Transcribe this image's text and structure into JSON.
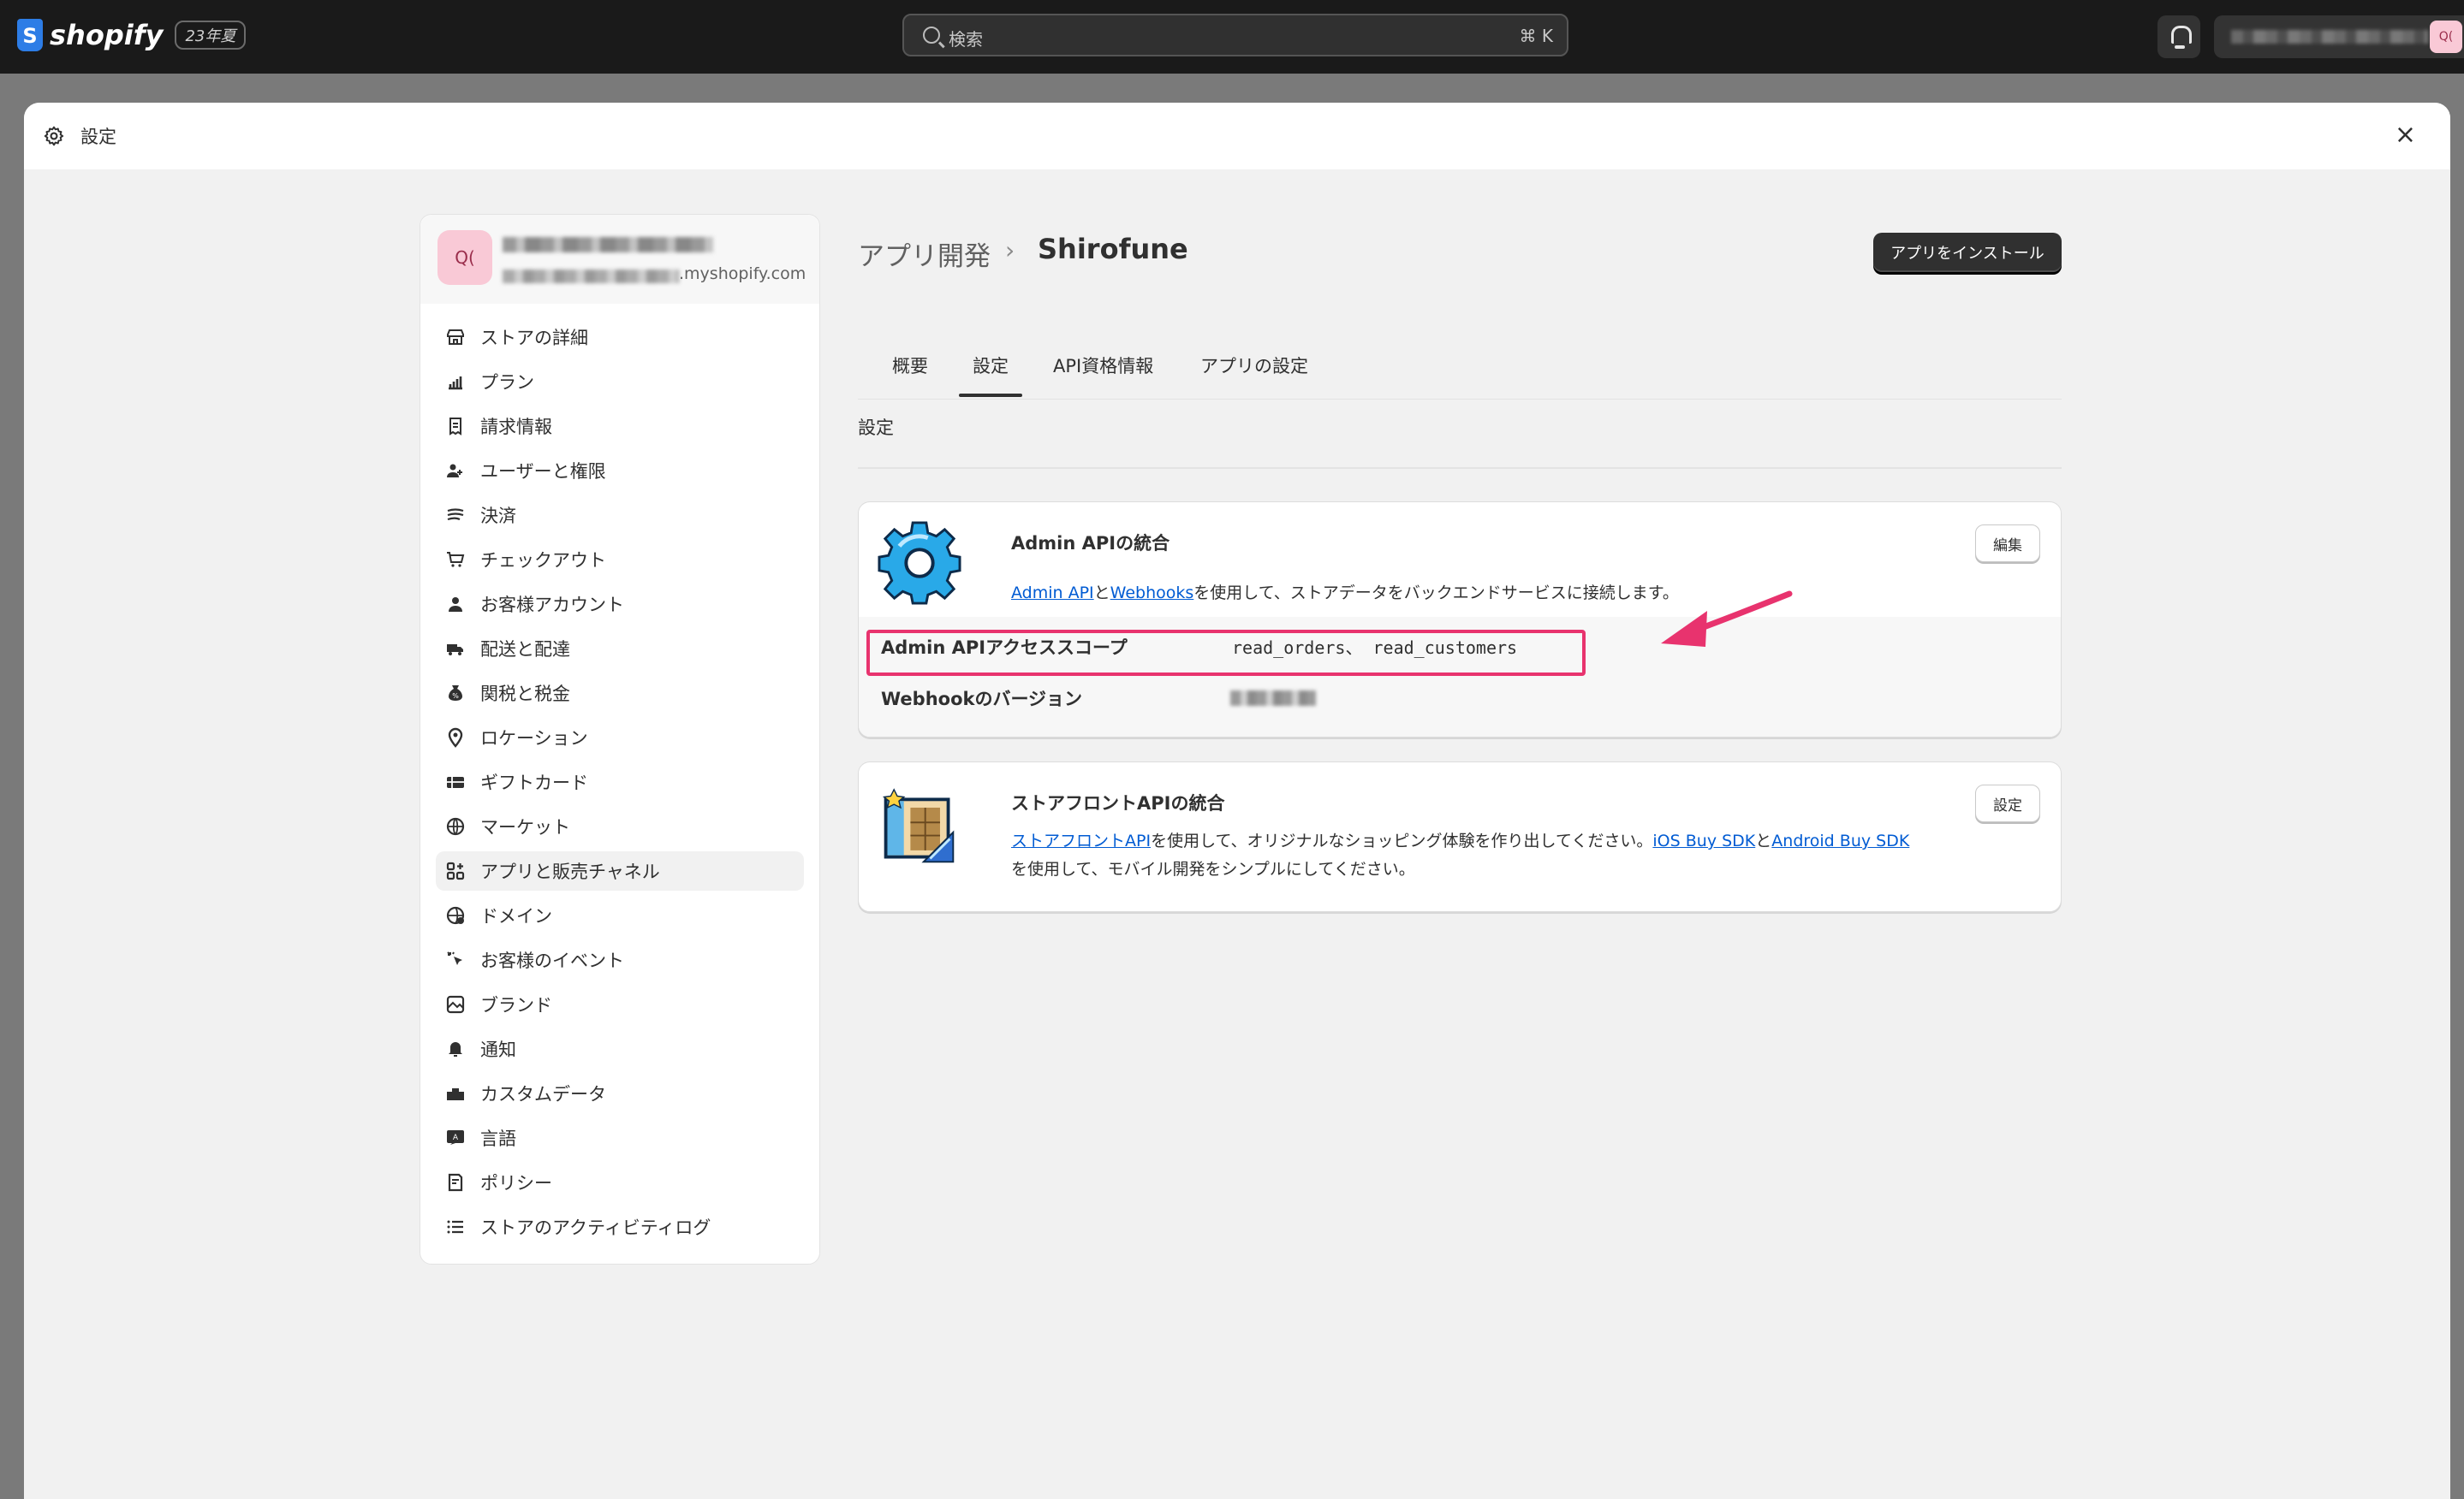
{
  "topbar": {
    "brand": "shopify",
    "brand_initial": "S",
    "edition": "23年夏",
    "search_placeholder": "検索",
    "search_shortcut": "⌘ K",
    "account_initials": "Q("
  },
  "modal": {
    "title": "設定",
    "close": "×"
  },
  "store": {
    "avatar": "Q(",
    "domain_suffix": ".myshopify.com"
  },
  "sidebar": {
    "items": [
      {
        "label": "ストアの詳細",
        "icon": "store-icon"
      },
      {
        "label": "プラン",
        "icon": "plan-icon"
      },
      {
        "label": "請求情報",
        "icon": "billing-icon"
      },
      {
        "label": "ユーザーと権限",
        "icon": "users-icon"
      },
      {
        "label": "決済",
        "icon": "payments-icon"
      },
      {
        "label": "チェックアウト",
        "icon": "cart-icon"
      },
      {
        "label": "お客様アカウント",
        "icon": "person-icon"
      },
      {
        "label": "配送と配達",
        "icon": "truck-icon"
      },
      {
        "label": "関税と税金",
        "icon": "tax-icon"
      },
      {
        "label": "ロケーション",
        "icon": "location-icon"
      },
      {
        "label": "ギフトカード",
        "icon": "gift-card-icon"
      },
      {
        "label": "マーケット",
        "icon": "globe-icon"
      },
      {
        "label": "アプリと販売チャネル",
        "icon": "apps-icon",
        "active": true
      },
      {
        "label": "ドメイン",
        "icon": "domain-icon"
      },
      {
        "label": "お客様のイベント",
        "icon": "cursor-icon"
      },
      {
        "label": "ブランド",
        "icon": "brand-icon"
      },
      {
        "label": "通知",
        "icon": "bell-icon"
      },
      {
        "label": "カスタムデータ",
        "icon": "data-icon"
      },
      {
        "label": "言語",
        "icon": "language-icon"
      },
      {
        "label": "ポリシー",
        "icon": "policy-icon"
      },
      {
        "label": "ストアのアクティビティログ",
        "icon": "list-icon"
      }
    ]
  },
  "main": {
    "breadcrumb_parent": "アプリ開発",
    "breadcrumb_sep": "›",
    "breadcrumb_current": "Shirofune",
    "install_button": "アプリをインストール",
    "tabs": [
      "概要",
      "設定",
      "API資格情報",
      "アプリの設定"
    ],
    "active_tab": "設定",
    "section_title": "設定",
    "admin_card": {
      "title": "Admin APIの統合",
      "link1": "Admin API",
      "mid1": "と",
      "link2": "Webhooks",
      "desc_tail": "を使用して、ストアデータをバックエンドサービスに接続します。",
      "button": "編集",
      "scope_label": "Admin APIアクセススコープ",
      "scope_value": "read_orders、 read_customers",
      "webhook_label": "Webhookのバージョン"
    },
    "storefront_card": {
      "title": "ストアフロントAPIの統合",
      "link1": "ストアフロントAPI",
      "desc1": "を使用して、オリジナルなショッピング体験を作り出してください。",
      "link2": "iOS Buy SDK",
      "mid": "と",
      "link3": "Android Buy SDK",
      "desc2": "を使用して、モバイル開発をシンプルにしてください。",
      "button": "設定"
    }
  },
  "colors": {
    "accent_highlight": "#e8336e",
    "link": "#005bd3",
    "topbar_bg": "#1a1a1a"
  }
}
